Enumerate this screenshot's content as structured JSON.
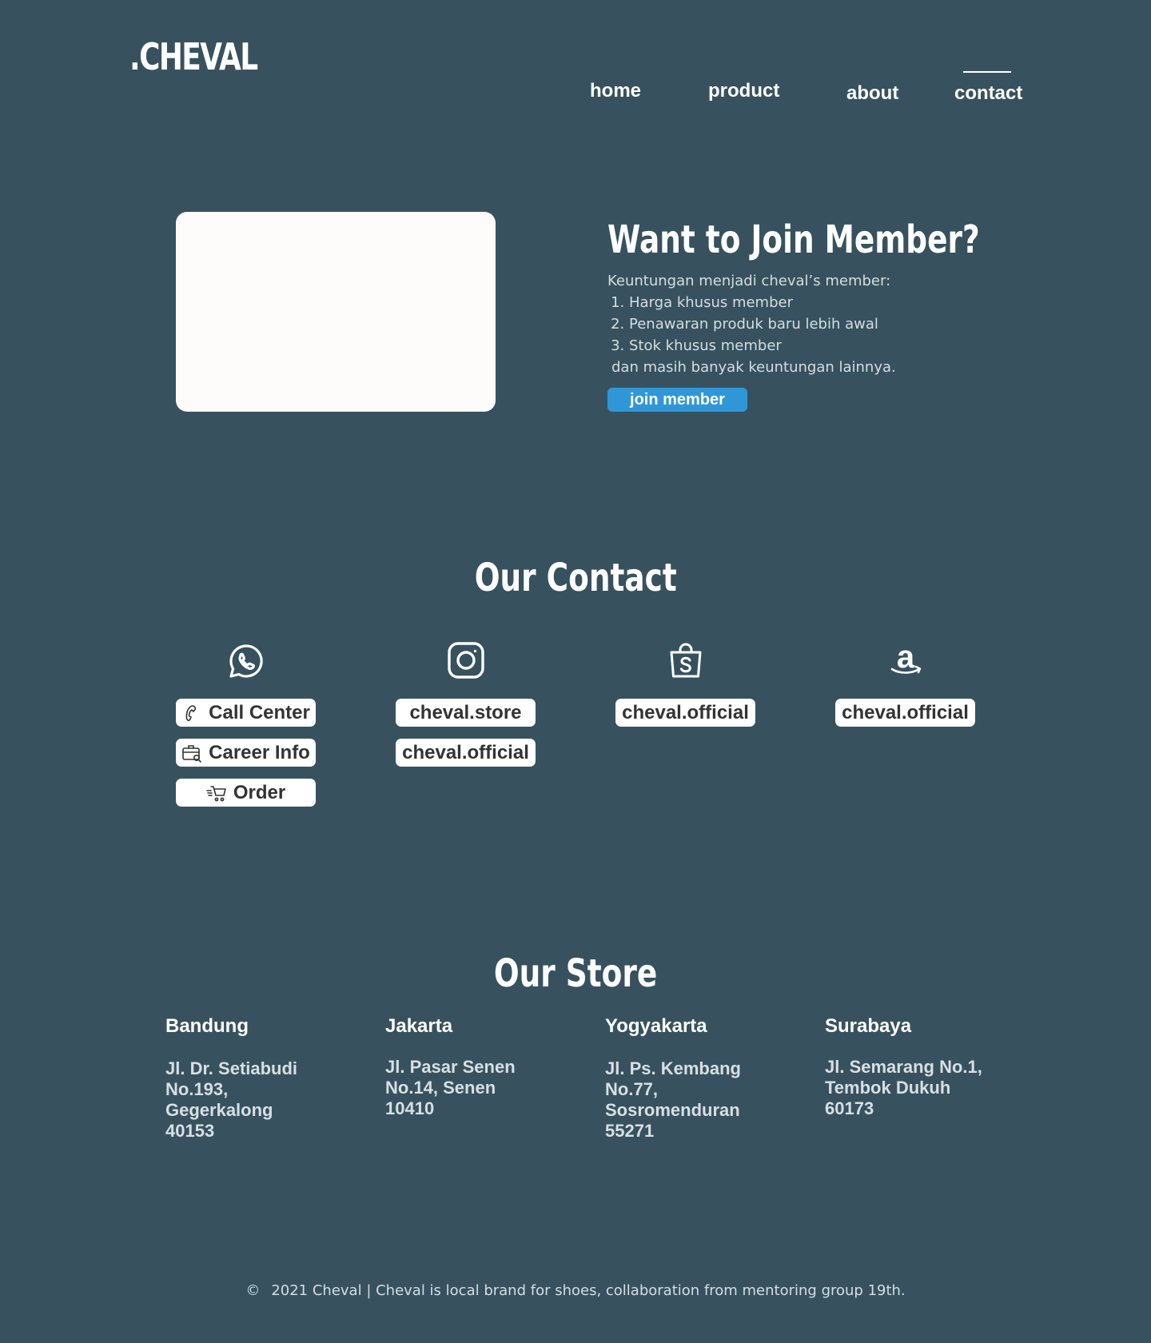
{
  "header": {
    "logo": ".CHEVAL",
    "nav": [
      {
        "label": "home"
      },
      {
        "label": "product"
      },
      {
        "label": "about"
      },
      {
        "label": "contact",
        "active": true
      }
    ]
  },
  "member": {
    "title": "Want to Join Member?",
    "intro": "Keuntungan menjadi cheval’s member:",
    "benefits": [
      "Harga khusus member",
      "Penawaran produk baru lebih awal",
      "Stok khusus member"
    ],
    "outro": "dan masih banyak keuntungan lainnya.",
    "button_label": "join member",
    "button_color": "#2f97d8"
  },
  "contact": {
    "title": "Our Contact",
    "columns": [
      {
        "icon": "whatsapp-icon",
        "items": [
          {
            "label": "Call Center",
            "icon": "phone-icon"
          },
          {
            "label": "Career Info",
            "icon": "briefcase-icon"
          },
          {
            "label": "Order",
            "icon": "cart-icon"
          }
        ]
      },
      {
        "icon": "instagram-icon",
        "items": [
          {
            "label": "cheval.store"
          },
          {
            "label": "cheval.official"
          }
        ]
      },
      {
        "icon": "shopee-icon",
        "items": [
          {
            "label": "cheval.official"
          }
        ]
      },
      {
        "icon": "amazon-icon",
        "items": [
          {
            "label": "cheval.official"
          }
        ]
      }
    ]
  },
  "store": {
    "title": "Our Store",
    "locations": [
      {
        "city": "Bandung",
        "address": [
          "Jl. Dr. Setiabudi",
          "No.193,",
          "Gegerkalong",
          "40153"
        ]
      },
      {
        "city": "Jakarta",
        "address": [
          "Jl. Pasar Senen",
          "No.14, Senen",
          "10410"
        ]
      },
      {
        "city": "Yogyakarta",
        "address": [
          "Jl. Ps. Kembang",
          "No.77,",
          "Sosromenduran",
          "55271"
        ]
      },
      {
        "city": "Surabaya",
        "address": [
          "Jl. Semarang No.1,",
          "Tembok Dukuh",
          "60173"
        ]
      }
    ]
  },
  "footer": {
    "copyright_symbol": "©",
    "text": "2021 Cheval | Cheval is local brand for shoes, collaboration from mentoring group 19th."
  },
  "colors": {
    "background": "#37525e",
    "accent": "#2f97d8",
    "pill_background": "#ffffff"
  }
}
